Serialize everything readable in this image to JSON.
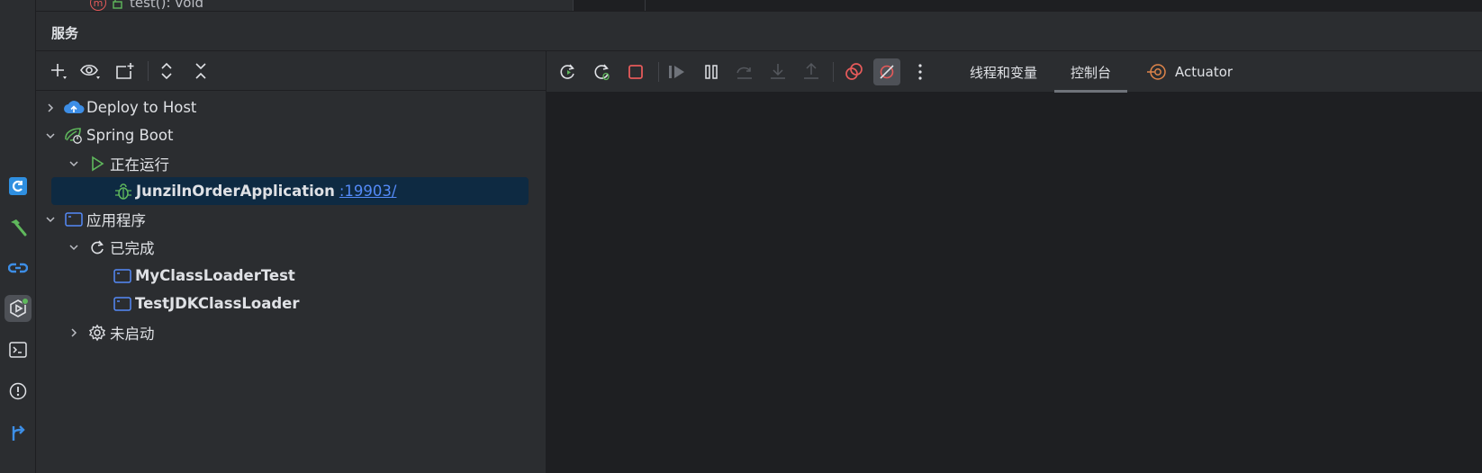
{
  "editor_top": {
    "method_badge": "m",
    "method_text": "test(): void"
  },
  "header": {
    "title": "服务"
  },
  "tree": {
    "deploy": "Deploy to Host",
    "spring_boot": "Spring Boot",
    "running": "正在运行",
    "app_name": "JunzilnOrderApplication",
    "app_port": ":19903/",
    "applications": "应用程序",
    "finished": "已完成",
    "item1": "MyClassLoaderTest",
    "item2": "TestJDKClassLoader",
    "not_started": "未启动"
  },
  "tabs": {
    "threads": "线程和变量",
    "console": "控制台",
    "actuator": "Actuator"
  },
  "colors": {
    "bg": "#2b2d30",
    "console_bg": "#1e1f22",
    "selection": "#0e2a42",
    "link": "#548af7",
    "green": "#5fb85c",
    "red": "#e55a5a",
    "blue_icon": "#3d8ee6"
  }
}
